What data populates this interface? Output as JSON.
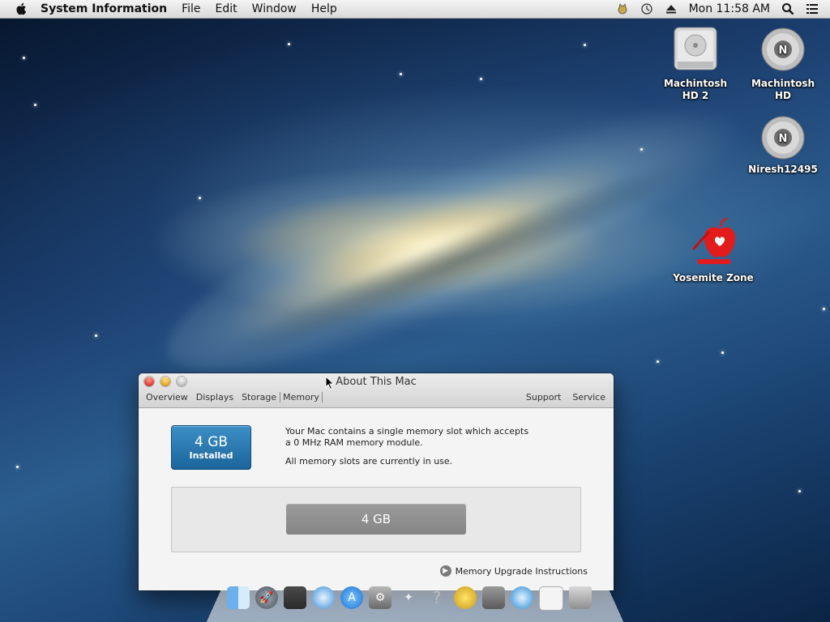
{
  "menubar": {
    "app_name": "System Information",
    "items": [
      "File",
      "Edit",
      "Window",
      "Help"
    ],
    "clock": "Mon 11:58 AM"
  },
  "desktop": {
    "icons": [
      {
        "label": "Machintosh HD 2",
        "icon": "hard-drive-icon"
      },
      {
        "label": "Machintosh HD",
        "icon": "disk-n-icon"
      },
      {
        "label": "Niresh12495",
        "icon": "disk-n-icon"
      },
      {
        "label": "Yosemite Zone",
        "icon": "yosemite-zone-icon"
      }
    ]
  },
  "window": {
    "title": "About This Mac",
    "tabs_left": [
      "Overview",
      "Displays",
      "Storage",
      "Memory"
    ],
    "active_tab": "Memory",
    "tabs_right": [
      "Support",
      "Service"
    ],
    "badge": {
      "size": "4 GB",
      "label": "Installed"
    },
    "description": {
      "line1": "Your Mac contains a single memory slot which accepts",
      "line2": "a 0 MHz RAM memory module.",
      "line3": "All memory slots are currently in use."
    },
    "slot_value": "4 GB",
    "upgrade_link": "Memory Upgrade Instructions"
  },
  "dock": {
    "items": [
      "finder-icon",
      "launchpad-icon",
      "photo-icon",
      "safari-icon",
      "app-store-icon",
      "system-preferences-icon",
      "unicorn-icon",
      "help-icon",
      "bee-icon",
      "scanner-icon",
      "time-machine-icon",
      "preview-icon",
      "trash-icon"
    ]
  },
  "colors": {
    "accent": "#1b659b",
    "slot": "#8e8e8e"
  }
}
